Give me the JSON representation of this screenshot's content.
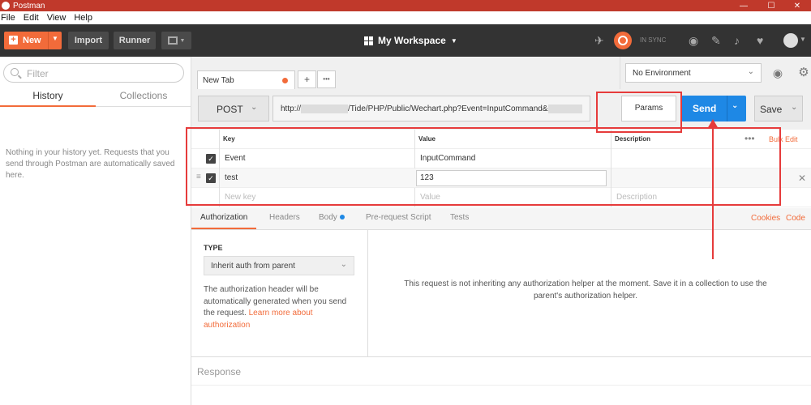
{
  "window": {
    "title": "Postman",
    "controls": [
      "—",
      "☐",
      "✕"
    ]
  },
  "menu": [
    "File",
    "Edit",
    "View",
    "Help"
  ],
  "header": {
    "new_label": "New",
    "import_label": "Import",
    "runner_label": "Runner",
    "workspace_label": "My Workspace",
    "sync_label": "IN SYNC",
    "accent": "#f26b3a"
  },
  "sidebar": {
    "filter_placeholder": "Filter",
    "tabs": [
      "History",
      "Collections"
    ],
    "active_tab": "History",
    "empty_message": "Nothing in your history yet. Requests that you send through Postman are automatically saved here."
  },
  "tabs": {
    "open_tab": "New Tab",
    "add": "+",
    "more": "•••"
  },
  "environment": {
    "selected": "No Environment"
  },
  "request": {
    "method": "POST",
    "url_prefix": "http://",
    "url_path": "/Tide/PHP/Public/Wechart.php?Event=InputCommand&",
    "params_label": "Params",
    "send_label": "Send",
    "save_label": "Save",
    "send_color": "#1e88e5"
  },
  "params": {
    "headers": {
      "key": "Key",
      "value": "Value",
      "description": "Description"
    },
    "bulk_edit": "Bulk Edit",
    "more": "•••",
    "rows": [
      {
        "key": "Event",
        "value": "InputCommand",
        "description": "",
        "checked": true
      },
      {
        "key": "test",
        "value": "123",
        "description": "",
        "checked": true
      }
    ],
    "new_row": {
      "key": "New key",
      "value": "Value",
      "description": "Description"
    }
  },
  "subtabs": {
    "items": [
      "Authorization",
      "Headers",
      "Body",
      "Pre-request Script",
      "Tests"
    ],
    "active": "Authorization",
    "cookies": "Cookies",
    "code": "Code"
  },
  "auth": {
    "type_label": "TYPE",
    "type_value": "Inherit auth from parent",
    "help_text": "The authorization header will be automatically generated when you send the request.",
    "help_link": "Learn more about authorization",
    "message": "This request is not inheriting any authorization helper at the moment. Save it in a collection to use the parent's authorization helper."
  },
  "response": {
    "label": "Response"
  },
  "annotations": {
    "color": "#e63b3b"
  }
}
